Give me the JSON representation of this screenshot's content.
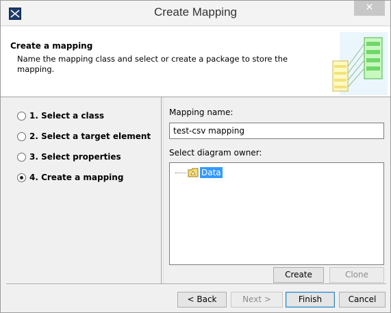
{
  "window": {
    "title": "Create Mapping",
    "close_glyph": "✕"
  },
  "header": {
    "title": "Create a mapping",
    "description": "Name the mapping class and select or create a package to store the mapping."
  },
  "steps": [
    {
      "label": "1. Select a class",
      "selected": false
    },
    {
      "label": "2. Select a target element",
      "selected": false
    },
    {
      "label": "3. Select properties",
      "selected": false
    },
    {
      "label": "4. Create a mapping",
      "selected": true
    }
  ],
  "form": {
    "mapping_name_label": "Mapping name:",
    "mapping_name_value": "test-csv mapping",
    "owner_label": "Select diagram owner:",
    "tree": [
      {
        "label": "Data",
        "icon": "package-folder-icon",
        "selected": true
      }
    ],
    "create_label": "Create",
    "clone_label": "Clone"
  },
  "footer": {
    "back_label": "< Back",
    "next_label": "Next >",
    "finish_label": "Finish",
    "cancel_label": "Cancel"
  },
  "colors": {
    "selection": "#3399ff",
    "folder": "#f5dc7c"
  }
}
